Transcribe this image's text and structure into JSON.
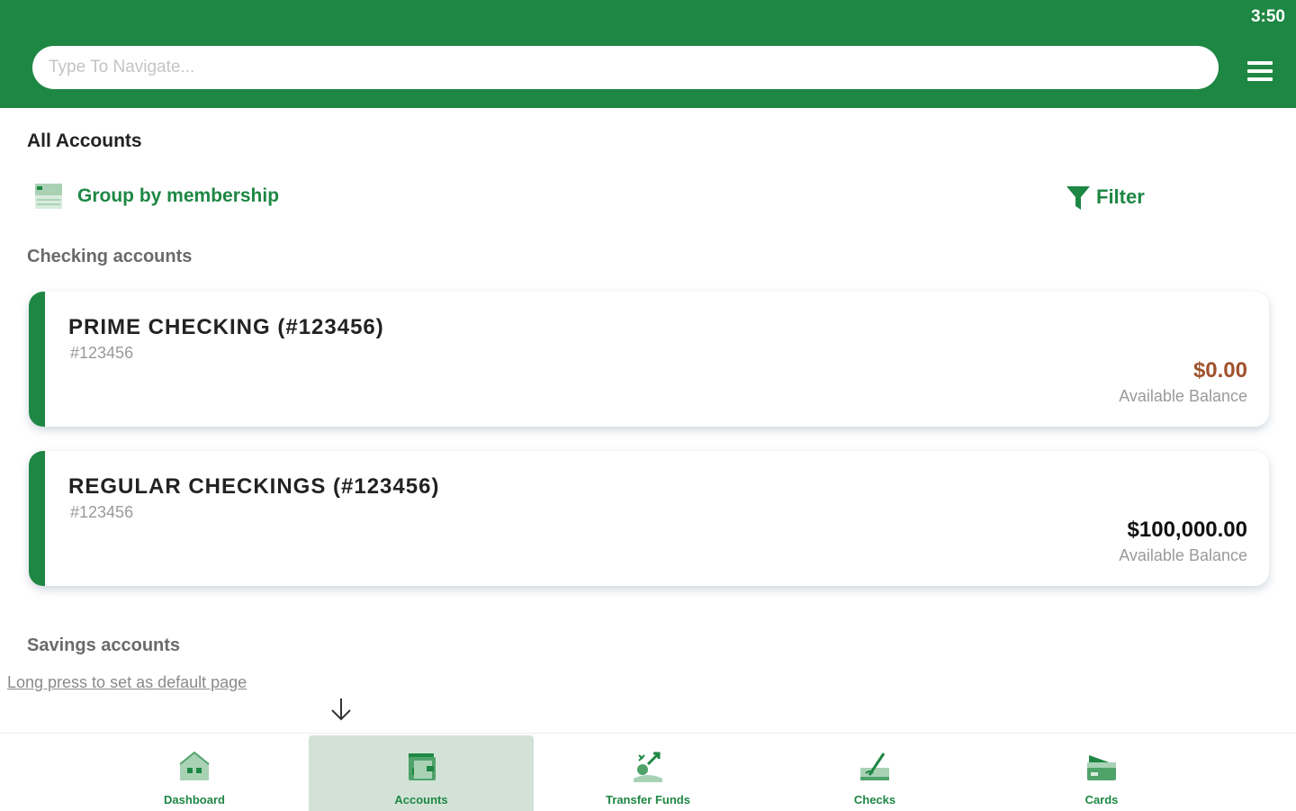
{
  "status": {
    "time": "3:50"
  },
  "header": {
    "search_placeholder": "Type To Navigate...",
    "menu_icon": "hamburger-menu-icon"
  },
  "page": {
    "title": "All Accounts",
    "group_label": "Group by membership",
    "filter_label": "Filter"
  },
  "sections": {
    "checking": "Checking accounts",
    "savings": "Savings accounts"
  },
  "accounts": [
    {
      "name": "PRIME CHECKING (#123456)",
      "number": "#123456",
      "balance": "$0.00",
      "balance_label": "Available Balance",
      "balance_color": "#a0522d"
    },
    {
      "name": "REGULAR CHECKINGS (#123456)",
      "number": "#123456",
      "balance": "$100,000.00",
      "balance_label": "Available Balance",
      "balance_color": "#111111"
    }
  ],
  "hint": "Long press to set as default page",
  "nav": [
    {
      "label": "Dashboard",
      "icon": "house-icon",
      "active": false
    },
    {
      "label": "Accounts",
      "icon": "wallet-icon",
      "active": true
    },
    {
      "label": "Transfer Funds",
      "icon": "transfer-icon",
      "active": false
    },
    {
      "label": "Checks",
      "icon": "check-pen-icon",
      "active": false
    },
    {
      "label": "Cards",
      "icon": "card-icon",
      "active": false
    }
  ],
  "colors": {
    "brand": "#1e8744",
    "nav_active_bg": "#d3e2d7"
  }
}
